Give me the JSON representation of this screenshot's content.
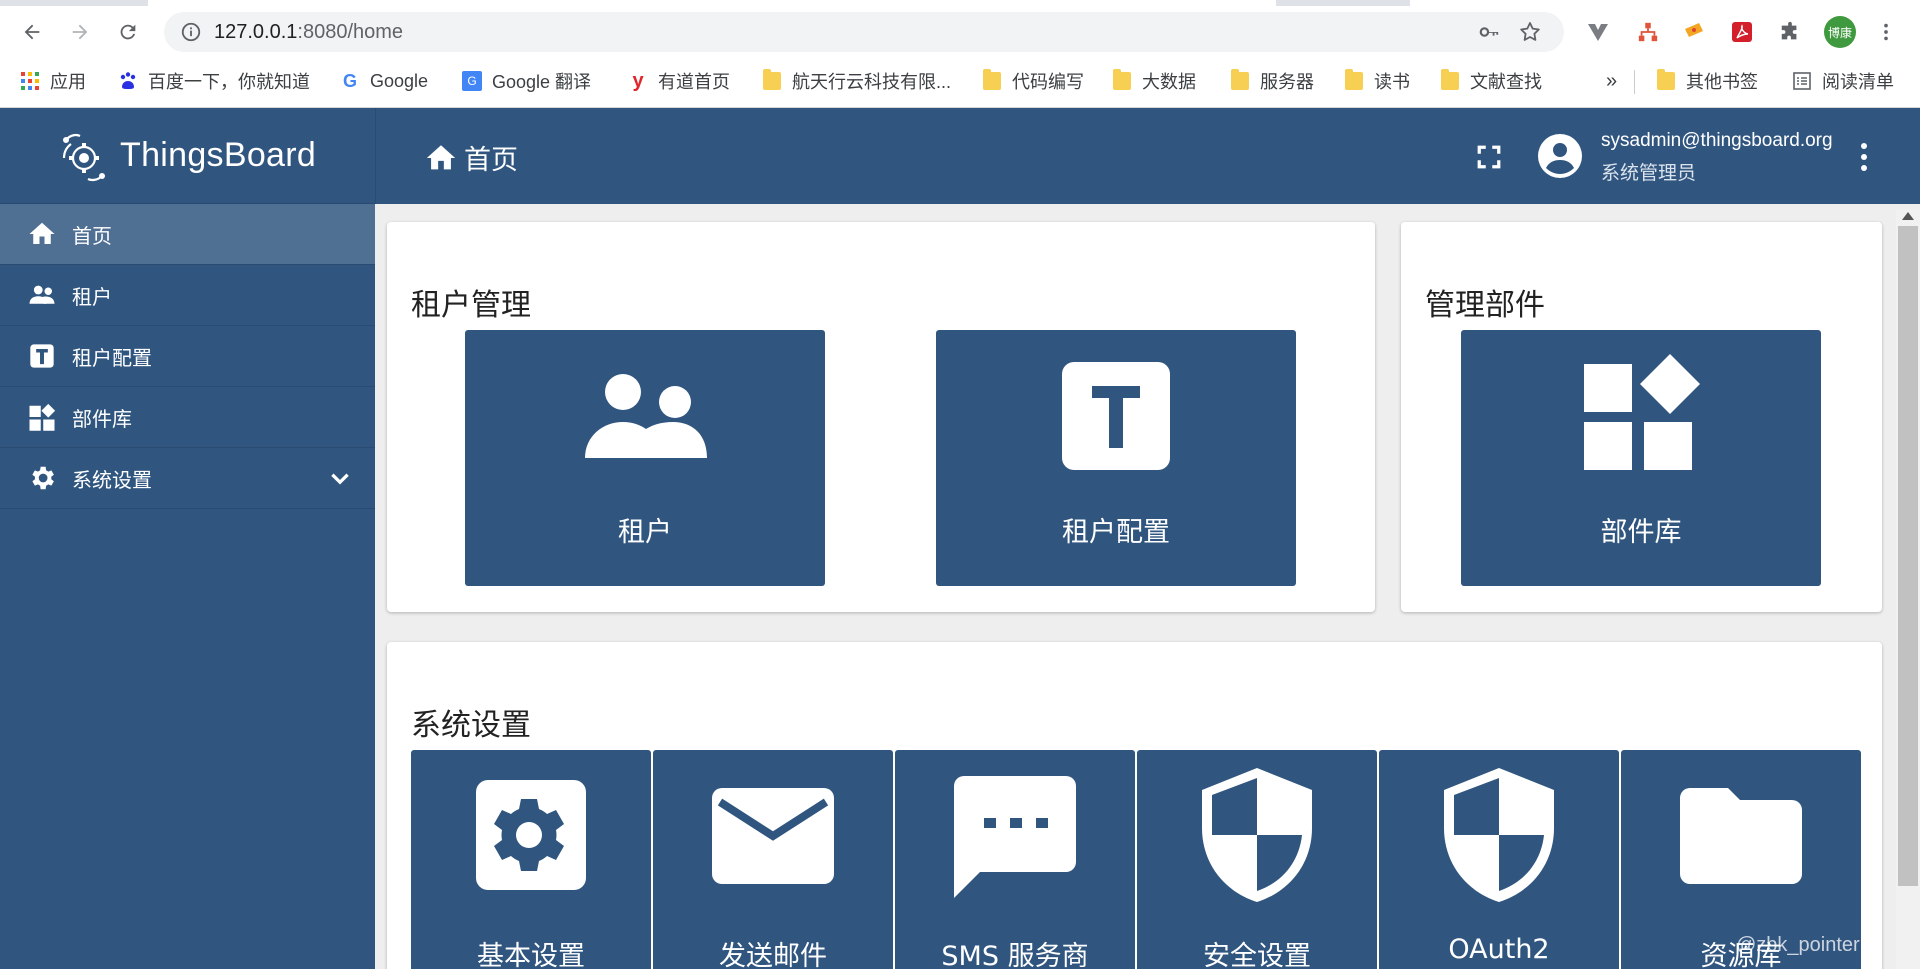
{
  "browser": {
    "url_host": "127.0.0.1",
    "url_rest": ":8080/home",
    "bookmarks": [
      {
        "label": "应用",
        "icon": "apps-grid-icon"
      },
      {
        "label": "百度一下，你就知道",
        "icon": "baidu-paw-icon"
      },
      {
        "label": "Google",
        "icon": "google-g-icon"
      },
      {
        "label": "Google 翻译",
        "icon": "google-translate-icon"
      },
      {
        "label": "有道首页",
        "icon": "youdao-icon"
      },
      {
        "label": "航天行云科技有限...",
        "icon": "folder-icon"
      },
      {
        "label": "代码编写",
        "icon": "folder-icon"
      },
      {
        "label": "大数据",
        "icon": "folder-icon"
      },
      {
        "label": "服务器",
        "icon": "folder-icon"
      },
      {
        "label": "读书",
        "icon": "folder-icon"
      },
      {
        "label": "文献查找",
        "icon": "folder-icon"
      }
    ],
    "overflow": "»",
    "other_bookmarks": "其他书签",
    "reading_list": "阅读清单",
    "profile_badge": "博康"
  },
  "app": {
    "brand": "ThingsBoard",
    "sidebar": [
      {
        "label": "首页",
        "icon": "home-icon",
        "active": true
      },
      {
        "label": "租户",
        "icon": "tenants-icon",
        "active": false
      },
      {
        "label": "租户配置",
        "icon": "tenant-profile-icon",
        "active": false
      },
      {
        "label": "部件库",
        "icon": "widgets-icon",
        "active": false
      },
      {
        "label": "系统设置",
        "icon": "settings-icon",
        "active": false
      }
    ],
    "breadcrumb": "首页",
    "user_email": "sysadmin@thingsboard.org",
    "user_role": "系统管理员"
  },
  "cards": {
    "tenant_mgmt": {
      "title": "租户管理",
      "tiles": [
        {
          "label": "租户",
          "icon": "tenants-icon"
        },
        {
          "label": "租户配置",
          "icon": "tenant-profile-icon"
        }
      ]
    },
    "widgets_mgmt": {
      "title": "管理部件",
      "tiles": [
        {
          "label": "部件库",
          "icon": "widgets-icon"
        }
      ]
    },
    "system_settings": {
      "title": "系统设置",
      "tiles": [
        {
          "label": "基本设置",
          "icon": "gear-icon"
        },
        {
          "label": "发送邮件",
          "icon": "mail-icon"
        },
        {
          "label": "SMS 服务商",
          "icon": "sms-icon"
        },
        {
          "label": "安全设置",
          "icon": "shield-icon"
        },
        {
          "label": "OAuth2",
          "icon": "shield-icon"
        },
        {
          "label": "资源库",
          "icon": "folder-icon"
        }
      ]
    }
  },
  "watermark": "@zbk_pointer",
  "colors": {
    "primary": "#305680",
    "active_nav": "#4f6f93",
    "background": "#eeeeee"
  }
}
